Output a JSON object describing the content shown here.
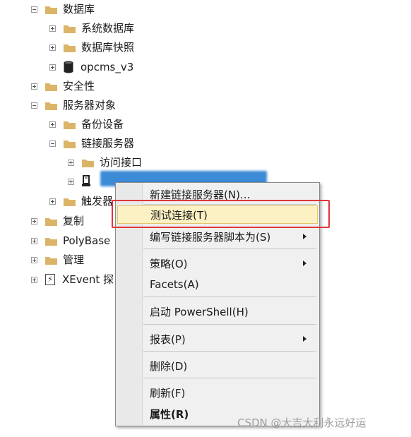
{
  "tree": {
    "items": [
      {
        "label": "数据库",
        "expander": "minus",
        "icon": "folder"
      },
      {
        "label": "系统数据库",
        "expander": "plus",
        "icon": "folder"
      },
      {
        "label": "数据库快照",
        "expander": "plus",
        "icon": "folder"
      },
      {
        "label": "opcms_v3",
        "expander": "plus",
        "icon": "database"
      },
      {
        "label": "安全性",
        "expander": "plus",
        "icon": "folder"
      },
      {
        "label": "服务器对象",
        "expander": "minus",
        "icon": "folder"
      },
      {
        "label": "备份设备",
        "expander": "plus",
        "icon": "folder"
      },
      {
        "label": "链接服务器",
        "expander": "minus",
        "icon": "folder"
      },
      {
        "label": "访问接口",
        "expander": "plus",
        "icon": "folder"
      },
      {
        "label": "",
        "expander": "plus",
        "icon": "linked-server",
        "selected": true
      },
      {
        "label": "触发器",
        "expander": "plus",
        "icon": "folder"
      },
      {
        "label": "复制",
        "expander": "plus",
        "icon": "folder"
      },
      {
        "label": "PolyBase",
        "expander": "plus",
        "icon": "folder"
      },
      {
        "label": "管理",
        "expander": "plus",
        "icon": "folder"
      },
      {
        "label": "XEvent 探",
        "expander": "plus",
        "icon": "xevent"
      }
    ]
  },
  "context_menu": {
    "items": [
      {
        "label": "新建链接服务器(N)...",
        "submenu": false
      },
      {
        "label": "测试连接(T)",
        "submenu": false,
        "highlighted": true
      },
      {
        "label": "编写链接服务器脚本为(S)",
        "submenu": true
      },
      {
        "label": "策略(O)",
        "submenu": true
      },
      {
        "label": "Facets(A)",
        "submenu": false
      },
      {
        "label": "启动 PowerShell(H)",
        "submenu": false
      },
      {
        "label": "报表(P)",
        "submenu": true
      },
      {
        "label": "删除(D)",
        "submenu": false
      },
      {
        "label": "刷新(F)",
        "submenu": false
      },
      {
        "label": "属性(R)",
        "submenu": false,
        "bold": true
      }
    ]
  },
  "watermark": "CSDN @大吉大利永远好运",
  "colors": {
    "folder": "#dcb467",
    "selection": "#3c8bd6",
    "menu_highlight": "#fcf1c2",
    "callout_box": "#e0373c"
  }
}
